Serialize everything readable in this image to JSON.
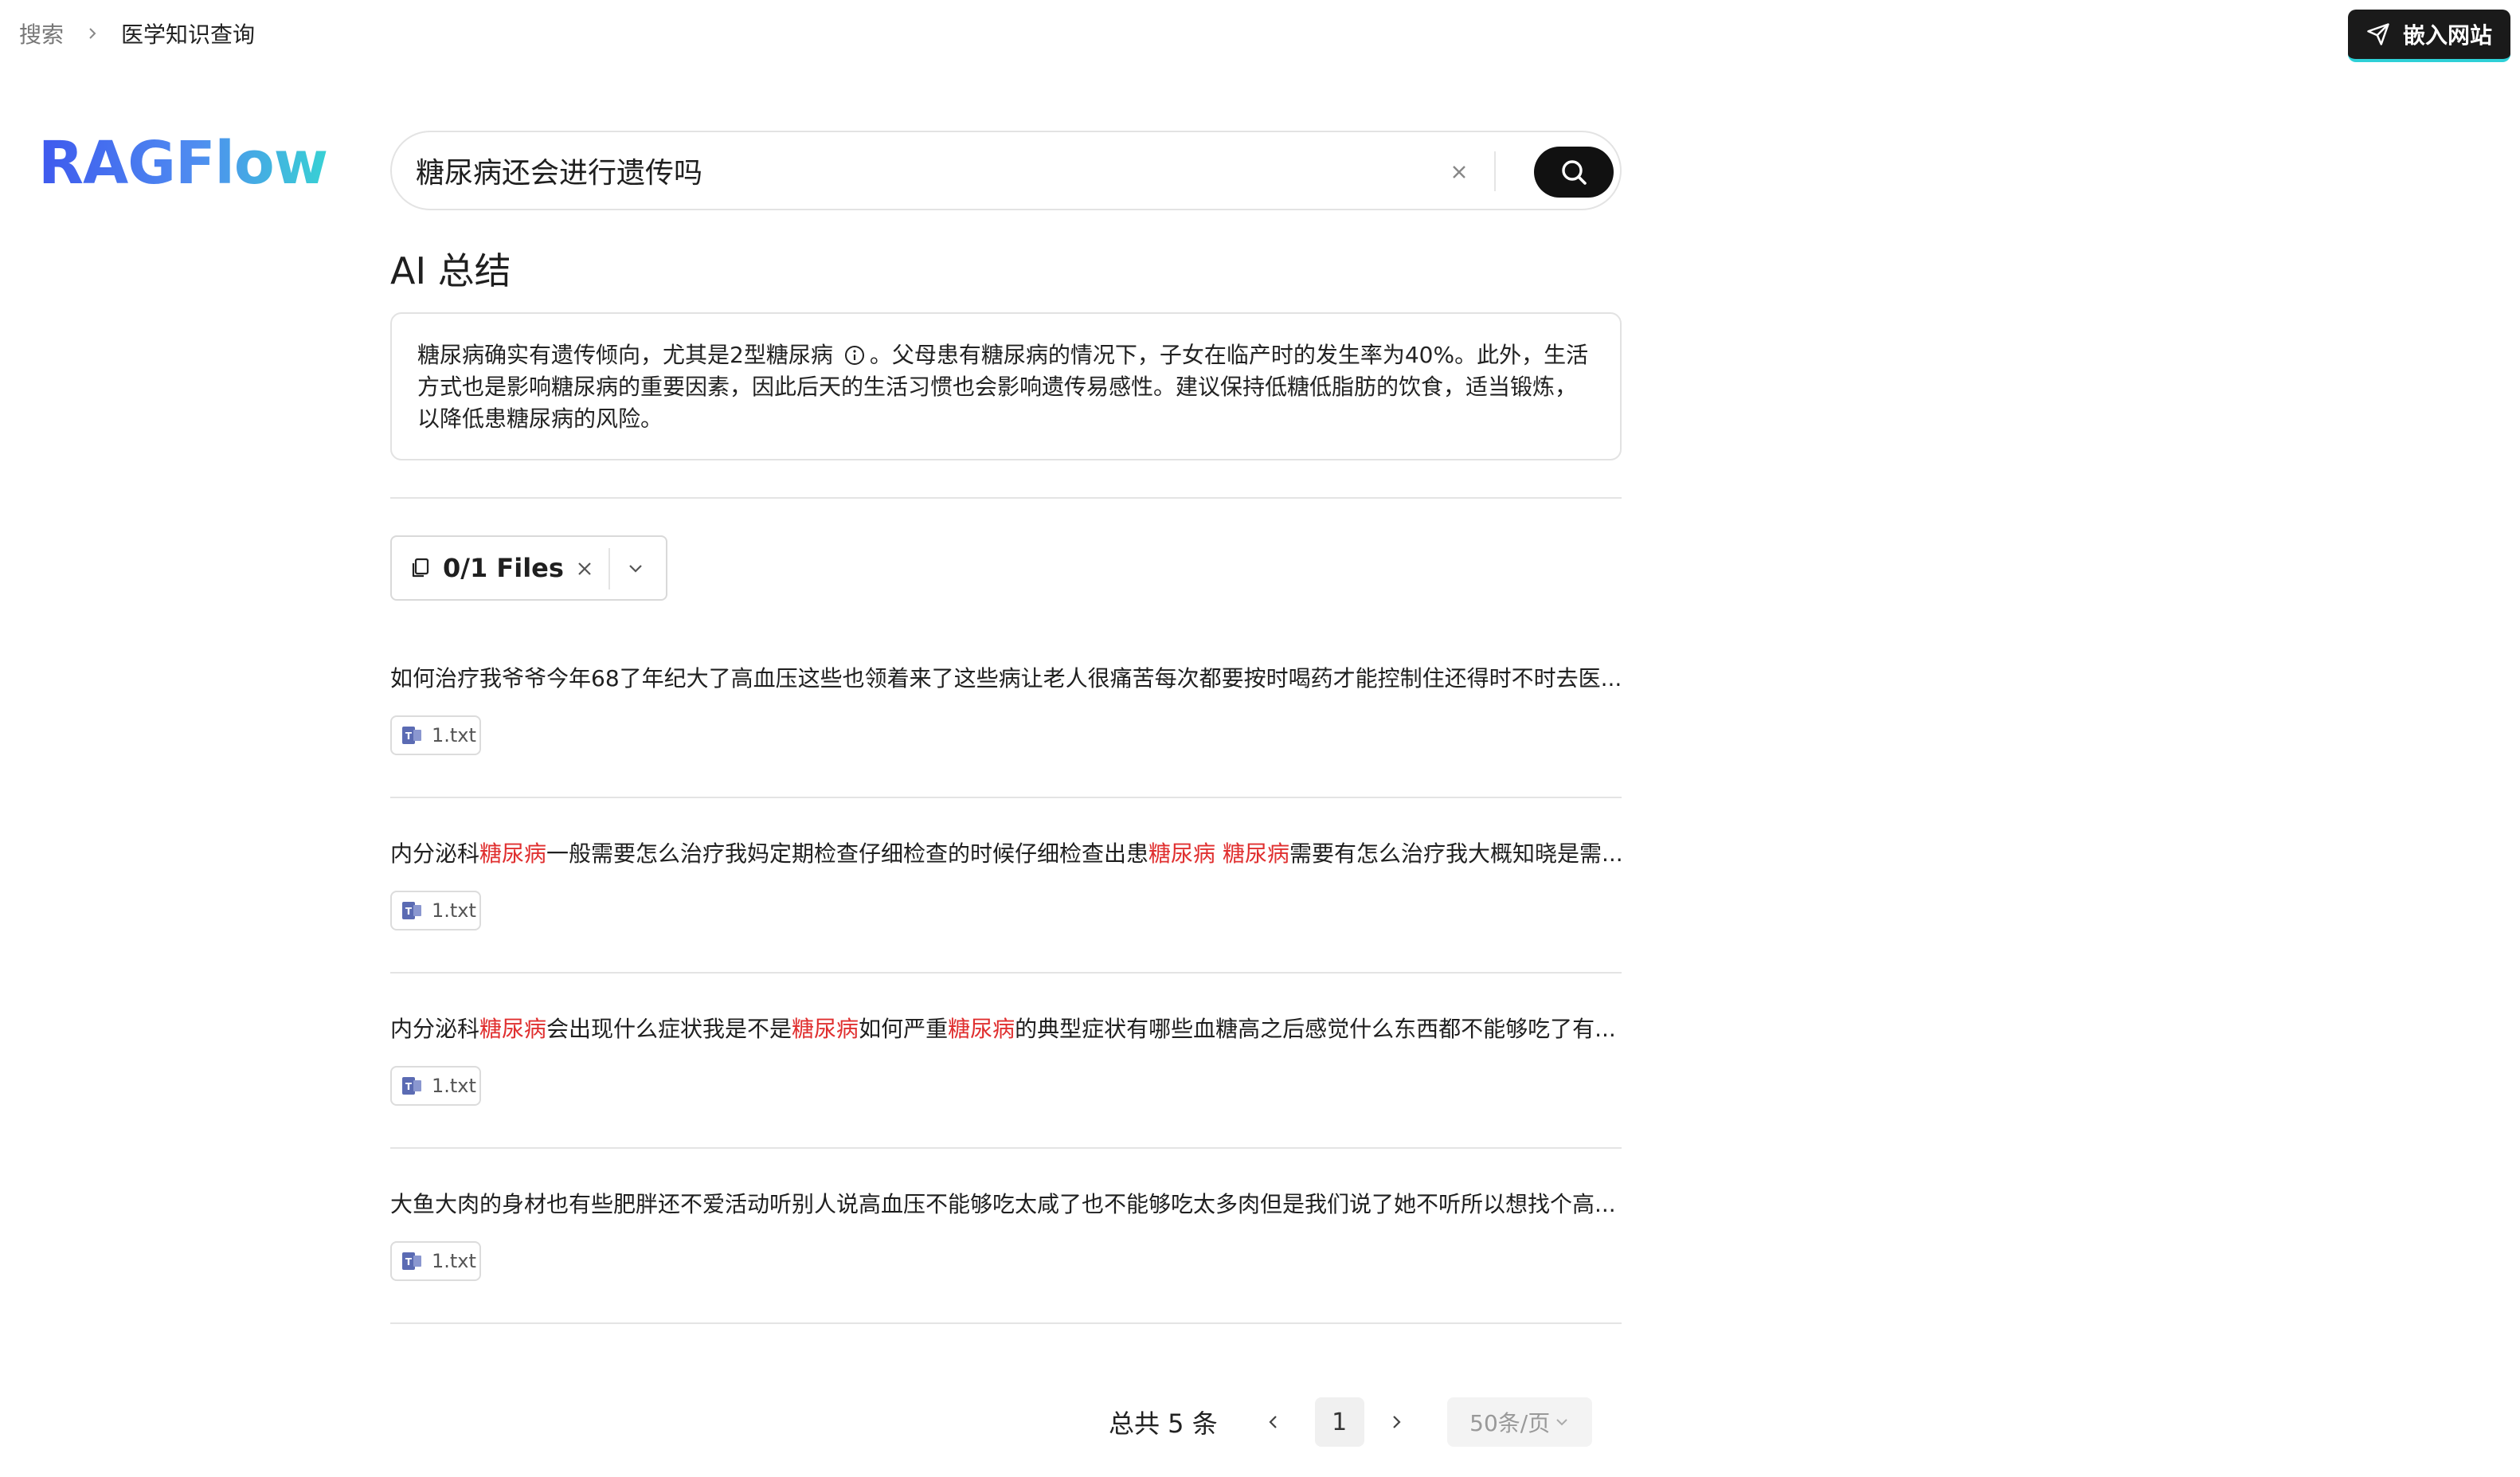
{
  "breadcrumb": {
    "root": "搜索",
    "current": "医学知识查询"
  },
  "header": {
    "embed_button": "嵌入网站",
    "embed_icon": "send-icon"
  },
  "logo": "RAGFlow",
  "search": {
    "value": "糖尿病还会进行遗传吗",
    "clear_icon": "close-icon",
    "submit_icon": "search-icon"
  },
  "ai_summary": {
    "title": "AI 总结",
    "text_before_icon": "糖尿病确实有遗传倾向，尤其是2型糖尿病",
    "text_after_icon": "。父母患有糖尿病的情况下，子女在临产时的发生率为40%。此外，生活方式也是影响糖尿病的重要因素，因此后天的生活习惯也会影响遗传易感性。建议保持低糖低脂肪的饮食，适当锻炼，以降低患糖尿病的风险。",
    "citation_icon": "info-icon"
  },
  "files_filter": {
    "label": "0/1 Files",
    "icon": "copy-files-icon"
  },
  "results": [
    {
      "segments": [
        {
          "text": "如何治疗我爷爷今年68了年纪大了高血压这些也领着来了这些病让老人很痛苦每次都要按时喝药才能控制住还得时不时去医...",
          "hl": false
        }
      ],
      "file": "1.txt"
    },
    {
      "segments": [
        {
          "text": "内分泌科",
          "hl": false
        },
        {
          "text": "糖尿病",
          "hl": true
        },
        {
          "text": "一般需要怎么治疗我妈定期检查仔细检查的时候仔细检查出患",
          "hl": false
        },
        {
          "text": "糖尿病 糖尿病",
          "hl": true
        },
        {
          "text": "需要有怎么治疗我大概知晓是需...",
          "hl": false
        }
      ],
      "file": "1.txt"
    },
    {
      "segments": [
        {
          "text": "内分泌科",
          "hl": false
        },
        {
          "text": "糖尿病",
          "hl": true
        },
        {
          "text": "会出现什么症状我是不是",
          "hl": false
        },
        {
          "text": "糖尿病",
          "hl": true
        },
        {
          "text": "如何严重",
          "hl": false
        },
        {
          "text": "糖尿病",
          "hl": true
        },
        {
          "text": "的典型症状有哪些血糖高之后感觉什么东西都不能够吃了有...",
          "hl": false
        }
      ],
      "file": "1.txt"
    },
    {
      "segments": [
        {
          "text": "大鱼大肉的身材也有些肥胖还不爱活动听别人说高血压不能够吃太咸了也不能够吃太多肉但是我们说了她不听所以想找个高...",
          "hl": false
        }
      ],
      "file": "1.txt"
    }
  ],
  "pagination": {
    "total": "总共 5 条",
    "current_page": "1",
    "page_size": "50条/页"
  },
  "colors": {
    "highlight": "#e02f2f",
    "logo_gradient_start": "#3e59ee",
    "logo_gradient_end": "#38d1d4",
    "embed_button_bg": "#1a1a1a"
  }
}
